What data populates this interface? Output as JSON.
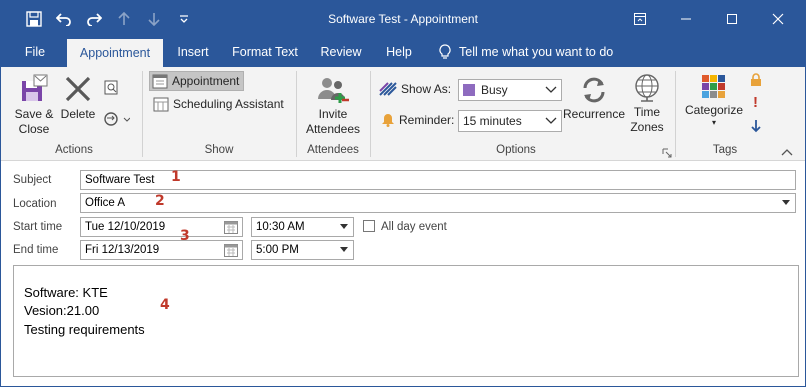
{
  "window": {
    "title": "Software Test  -  Appointment"
  },
  "quick_access": {
    "save": "save-icon",
    "undo": "undo-icon",
    "redo": "redo-icon",
    "up": "up-arrow-icon",
    "down": "down-arrow-icon",
    "customize": "customize-icon"
  },
  "tabs": [
    {
      "label": "File"
    },
    {
      "label": "Appointment"
    },
    {
      "label": "Insert"
    },
    {
      "label": "Format Text"
    },
    {
      "label": "Review"
    },
    {
      "label": "Help"
    }
  ],
  "tell_me": "Tell me what you want to do",
  "ribbon": {
    "actions": {
      "save_close_1": "Save &",
      "save_close_2": "Close",
      "delete": "Delete",
      "group": "Actions"
    },
    "show": {
      "appointment": "Appointment",
      "scheduling": "Scheduling Assistant",
      "group": "Show"
    },
    "attendees": {
      "invite_1": "Invite",
      "invite_2": "Attendees",
      "group": "Attendees"
    },
    "options": {
      "show_as_label": "Show As:",
      "show_as_value": "Busy",
      "reminder_label": "Reminder:",
      "reminder_value": "15 minutes",
      "recurrence": "Recurrence",
      "time_1": "Time",
      "time_2": "Zones",
      "group": "Options"
    },
    "tags": {
      "categorize": "Categorize",
      "group": "Tags"
    }
  },
  "form": {
    "subject_label": "Subject",
    "subject_value": "Software Test",
    "location_label": "Location",
    "location_value": "Office A",
    "start_label": "Start time",
    "start_date": "Tue 12/10/2019",
    "start_time": "10:30 AM",
    "end_label": "End time",
    "end_date": "Fri 12/13/2019",
    "end_time": "5:00 PM",
    "all_day_label": "All day event",
    "body_lines": [
      "Software: KTE",
      "Vesion:21.00",
      "Testing requirements"
    ]
  },
  "callouts": [
    "1",
    "2",
    "3",
    "4"
  ],
  "colors": {
    "brand": "#2b579a",
    "callout": "#c0392b",
    "busy": "#8e6bbf"
  }
}
